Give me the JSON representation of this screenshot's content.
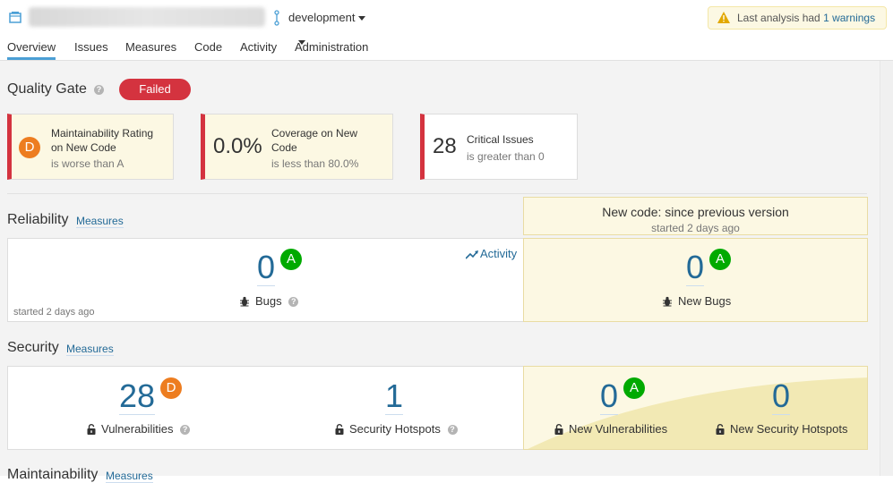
{
  "header": {
    "branch": "development",
    "warning": {
      "text": "Last analysis had ",
      "link": "1 warnings"
    }
  },
  "nav": {
    "items": [
      "Overview",
      "Issues",
      "Measures",
      "Code",
      "Activity",
      "Administration"
    ]
  },
  "quality_gate": {
    "title": "Quality Gate",
    "status": "Failed",
    "conditions": [
      {
        "rating": "D",
        "title": "Maintainability Rating on New Code",
        "detail": "is worse than A"
      },
      {
        "value": "0.0%",
        "title": "Coverage on New Code",
        "detail": "is less than 80.0%"
      },
      {
        "value": "28",
        "title": "Critical Issues",
        "detail": "is greater than 0"
      }
    ]
  },
  "new_code": {
    "title": "New code: since previous version",
    "subtitle": "started 2 days ago"
  },
  "reliability": {
    "title": "Reliability",
    "measures_link": "Measures",
    "activity_link": "Activity",
    "bugs": {
      "value": "0",
      "rating": "A",
      "label": "Bugs"
    },
    "started": "started 2 days ago",
    "new_bugs": {
      "value": "0",
      "rating": "A",
      "label": "New Bugs"
    }
  },
  "security": {
    "title": "Security",
    "measures_link": "Measures",
    "vulnerabilities": {
      "value": "28",
      "rating": "D",
      "label": "Vulnerabilities"
    },
    "hotspots": {
      "value": "1",
      "label": "Security Hotspots"
    },
    "new_vulnerabilities": {
      "value": "0",
      "rating": "A",
      "label": "New Vulnerabilities"
    },
    "new_hotspots": {
      "value": "0",
      "label": "New Security Hotspots"
    }
  },
  "maintainability": {
    "title": "Maintainability",
    "measures_link": "Measures"
  },
  "colors": {
    "failed": "#d4333f",
    "rating_A": "#00aa00",
    "rating_D": "#ed7d20",
    "link": "#236a97",
    "new_code_bg": "#fcf8e3"
  }
}
